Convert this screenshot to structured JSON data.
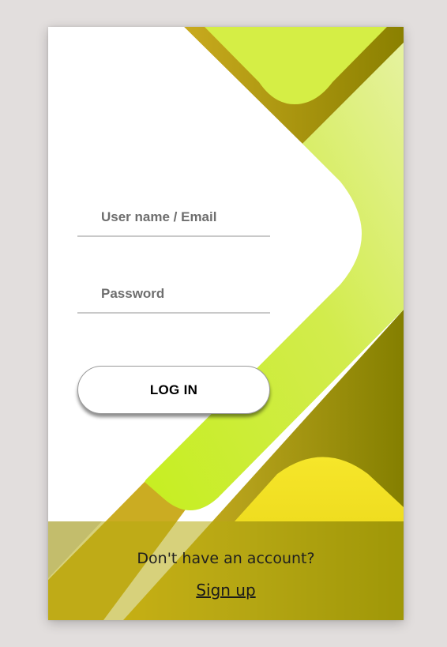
{
  "login_form": {
    "username_placeholder": "User name / Email",
    "password_placeholder": "Password",
    "login_button_label": "LOG IN"
  },
  "footer": {
    "question": "Don't have an account?",
    "signup_label": "Sign up"
  },
  "colors": {
    "page_background": "#e2dedd",
    "card_background": "#ffffff",
    "lime": "#d4ef45",
    "olive": "#8a8400",
    "mustard": "#c4a81d",
    "yellow": "#f4e428",
    "footer_overlay": "#b6ac0e"
  }
}
